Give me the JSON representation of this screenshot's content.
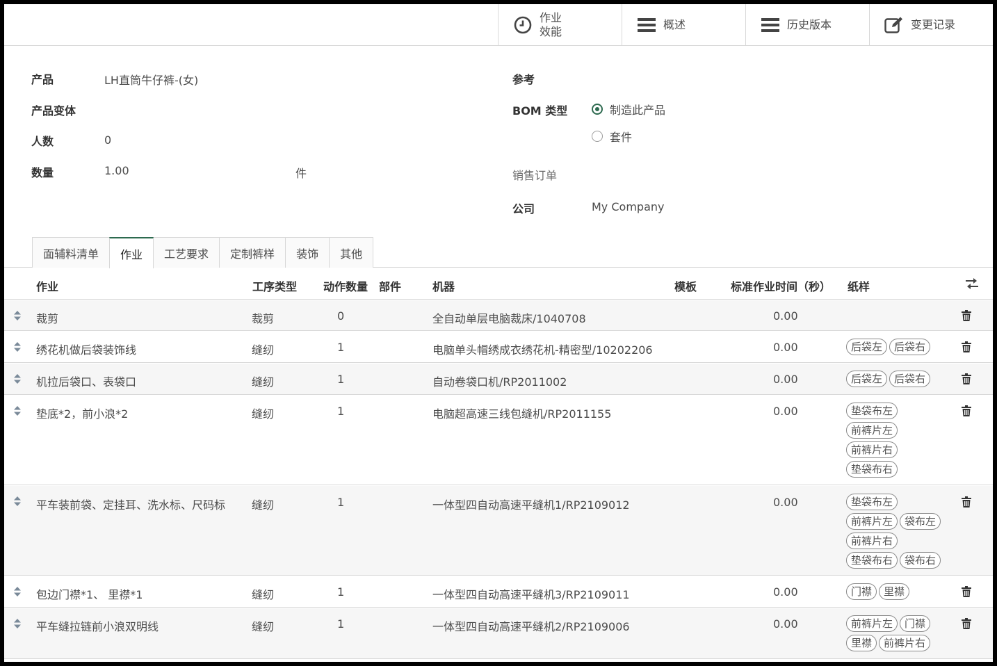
{
  "top_buttons": {
    "efficiency_line1": "作业",
    "efficiency_line2": "效能",
    "overview": "概述",
    "history": "历史版本",
    "changelog": "变更记录"
  },
  "form": {
    "product_label": "产品",
    "product_value": "LH直筒牛仔裤-(女)",
    "variant_label": "产品变体",
    "headcount_label": "人数",
    "headcount_value": "0",
    "quantity_label": "数量",
    "quantity_value": "1.00",
    "quantity_unit": "件",
    "reference_label": "参考",
    "bom_type_label": "BOM 类型",
    "bom_type_options": [
      "制造此产品",
      "套件"
    ],
    "bom_type_selected": "制造此产品",
    "sale_order_label": "销售订单",
    "company_label": "公司",
    "company_value": "My Company"
  },
  "tabs": [
    "面辅料清单",
    "作业",
    "工艺要求",
    "定制裤样",
    "装饰",
    "其他"
  ],
  "active_tab": "作业",
  "table": {
    "headers": {
      "operation": "作业",
      "process_type": "工序类型",
      "action_count": "动作数量",
      "part": "部件",
      "machine": "机器",
      "template": "模板",
      "std_time": "标准作业时间（秒）",
      "pattern": "纸样"
    },
    "rows": [
      {
        "operation": "裁剪",
        "process_type": "裁剪",
        "action_count": "0",
        "machine": "全自动单层电脑裁床/1040708",
        "std_time": "0.00",
        "patterns": []
      },
      {
        "operation": "绣花机做后袋装饰线",
        "process_type": "缝纫",
        "action_count": "1",
        "machine": "电脑单头帽绣成衣绣花机-精密型/10202206",
        "std_time": "0.00",
        "patterns": [
          "后袋左",
          "后袋右"
        ]
      },
      {
        "operation": "机拉后袋口、表袋口",
        "process_type": "缝纫",
        "action_count": "1",
        "machine": "自动卷袋口机/RP2011002",
        "std_time": "0.00",
        "patterns": [
          "后袋左",
          "后袋右"
        ]
      },
      {
        "operation": "垫底*2，前小浪*2",
        "process_type": "缝纫",
        "action_count": "1",
        "machine": "电脑超高速三线包缝机/RP2011155",
        "std_time": "0.00",
        "patterns": [
          "垫袋布左",
          "前裤片左",
          "前裤片右",
          "垫袋布右"
        ]
      },
      {
        "operation": "平车装前袋、定挂耳、洗水标、尺码标",
        "process_type": "缝纫",
        "action_count": "1",
        "machine": "一体型四自动高速平缝机1/RP2109012",
        "std_time": "0.00",
        "patterns": [
          "垫袋布左",
          "前裤片左",
          "袋布左",
          "前裤片右",
          "垫袋布右",
          "袋布右"
        ]
      },
      {
        "operation": "包边门襟*1、 里襟*1",
        "process_type": "缝纫",
        "action_count": "1",
        "machine": "一体型四自动高速平缝机3/RP2109011",
        "std_time": "0.00",
        "patterns": [
          "门襟",
          "里襟"
        ]
      },
      {
        "operation": "平车缝拉链前小浪双明线",
        "process_type": "缝纫",
        "action_count": "1",
        "machine": "一体型四自动高速平缝机2/RP2109006",
        "std_time": "0.00",
        "patterns": [
          "前裤片左",
          "门襟",
          "里襟",
          "前裤片右"
        ]
      }
    ]
  }
}
